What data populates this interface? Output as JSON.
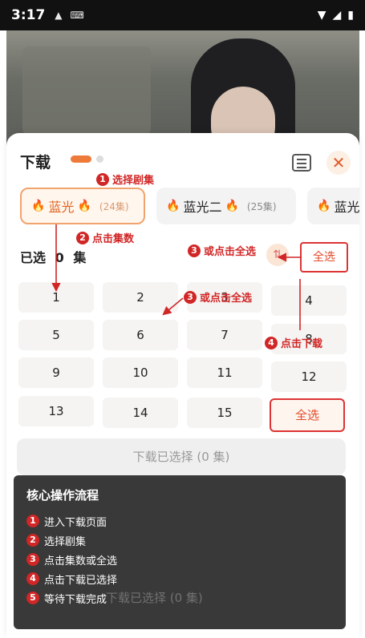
{
  "status_bar": {
    "time": "3:17"
  },
  "sheet": {
    "title": "下载",
    "sources": [
      {
        "label": "蓝光",
        "count": "(24集)",
        "active": true
      },
      {
        "label": "蓝光二",
        "count": "(25集)",
        "active": false
      },
      {
        "label": "蓝光",
        "count": "",
        "active": false
      }
    ],
    "selected": {
      "label": "已选",
      "count": "0",
      "unit": "集"
    },
    "select_all_label": "全选",
    "episodes": [
      "1",
      "2",
      "3",
      "4",
      "5",
      "6",
      "7",
      "8",
      "9",
      "10",
      "11",
      "12",
      "13",
      "14",
      "15"
    ],
    "grid_select_all": "全选",
    "download_button": "下载已选择 (0 集)"
  },
  "annotations": {
    "a1": {
      "num": "1",
      "text": "选择剧集"
    },
    "a2": {
      "num": "2",
      "text": "点击集数"
    },
    "a3a": {
      "num": "3",
      "text": "或点击全选"
    },
    "a3b": {
      "num": "3",
      "text": "或点击全选"
    },
    "a4": {
      "num": "4",
      "text": "点击下载"
    }
  },
  "overlay": {
    "title": "核心操作流程",
    "steps": [
      {
        "num": "1",
        "text": "进入下载页面"
      },
      {
        "num": "2",
        "text": "选择剧集"
      },
      {
        "num": "3",
        "text": "点击集数或全选"
      },
      {
        "num": "4",
        "text": "点击下载已选择"
      },
      {
        "num": "5",
        "text": "等待下载完成"
      }
    ],
    "ghost": "下载已选择 (0 集)"
  },
  "colors": {
    "accent": "#ee7a3a",
    "annotation": "#d12626"
  }
}
